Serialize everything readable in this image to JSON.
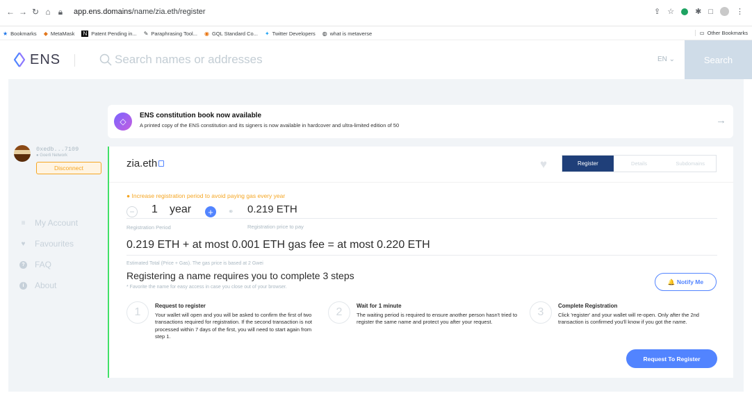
{
  "browser": {
    "url_domain": "app.ens.domains",
    "url_path": "/name/zia.eth/register",
    "bookmarks": [
      "Bookmarks",
      "MetaMask",
      "Patent Pending in...",
      "Paraphrasing Tool...",
      "GQL Standard Co...",
      "Twitter Developers",
      "what is metaverse"
    ],
    "other_bookmarks": "Other Bookmarks"
  },
  "header": {
    "logo": "ENS",
    "search_placeholder": "Search names or addresses",
    "language": "EN ⌄",
    "search_button": "Search"
  },
  "banner": {
    "title": "ENS constitution book now available",
    "subtitle": "A printed copy of the ENS constitution and its signers is now available in hardcover and ultra-limited edition of 50",
    "arrow": "→"
  },
  "user": {
    "address": "0xedb...7109",
    "network": "● Goerli Network",
    "disconnect": "Disconnect"
  },
  "nav": [
    {
      "label": "My Account",
      "icon": "≡"
    },
    {
      "label": "Favourites",
      "icon": "♥"
    },
    {
      "label": "FAQ",
      "icon": "?"
    },
    {
      "label": "About",
      "icon": "i"
    }
  ],
  "card": {
    "domain": "zia.eth",
    "tabs": [
      "Register",
      "Details",
      "Subdomains"
    ],
    "warning": "● Increase registration period to avoid paying gas every year",
    "period_value": "1",
    "period_unit": "year",
    "price": "0.219 ETH",
    "period_label": "Registration Period",
    "price_label": "Registration price to pay",
    "total": "0.219 ETH + at most 0.001 ETH gas fee = at most 0.220 ETH",
    "total_label": "Estimated Total (Price + Gas). The gas price is based at 2 Gwei",
    "steps_title": "Registering a name requires you to complete 3 steps",
    "steps_note": "* Favorite the name for easy access in case you close out of your browser.",
    "notify": "🔔 Notify Me",
    "steps": [
      {
        "num": "1",
        "title": "Request to register",
        "desc": "Your wallet will open and you will be asked to confirm the first of two transactions required for registration. If the second transaction is not processed within 7 days of the first, you will need to start again from step 1."
      },
      {
        "num": "2",
        "title": "Wait for 1 minute",
        "desc": "The waiting period is required to ensure another person hasn't tried to register the same name and protect you after your request."
      },
      {
        "num": "3",
        "title": "Complete Registration",
        "desc": "Click 'register' and your wallet will re-open. Only after the 2nd transaction is confirmed you'll know if you got the name."
      }
    ],
    "request_button": "Request To Register"
  }
}
